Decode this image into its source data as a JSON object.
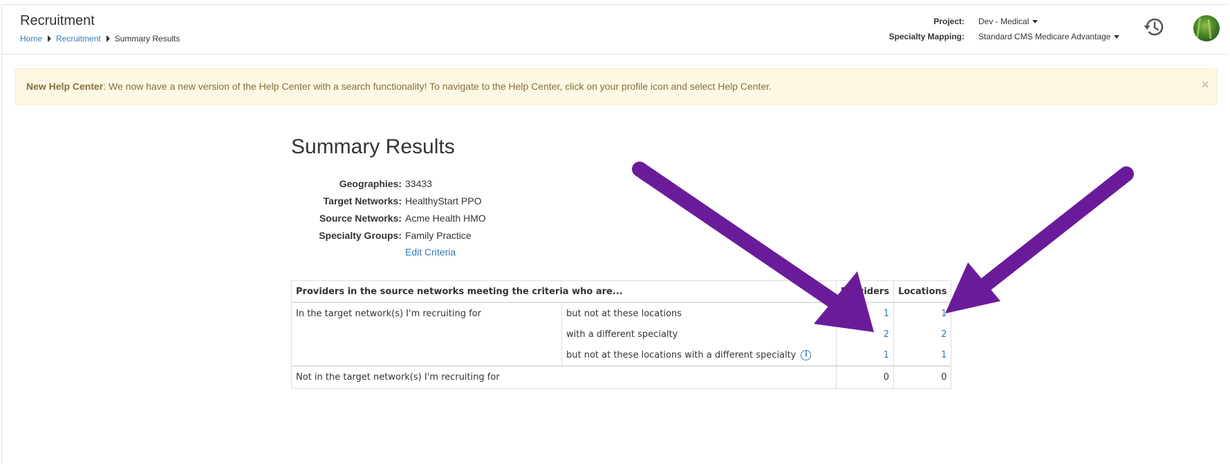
{
  "header": {
    "title": "Recruitment",
    "breadcrumb": [
      "Home",
      "Recruitment",
      "Summary Results"
    ],
    "project_label": "Project:",
    "project_value": "Dev - Medical",
    "mapping_label": "Specialty Mapping:",
    "mapping_value": "Standard CMS Medicare Advantage",
    "icons": [
      "history-icon",
      "avatar"
    ]
  },
  "alert": {
    "title": "New Help Center",
    "message": ": We now have a new version of the Help Center with a search functionality! To navigate to the Help Center, click on your profile icon and select Help Center.",
    "close": "×"
  },
  "main": {
    "title": "Summary Results",
    "criteria": [
      {
        "label": "Geographies:",
        "value": "33433"
      },
      {
        "label": "Target Networks:",
        "value": "HealthyStart PPO"
      },
      {
        "label": "Source Networks:",
        "value": "Acme Health HMO"
      },
      {
        "label": "Specialty Groups:",
        "value": "Family Practice"
      }
    ],
    "edit_link": "Edit Criteria"
  },
  "table": {
    "headers": [
      "Providers in the source networks meeting the criteria who are...",
      "Providers",
      "Locations"
    ],
    "group1_label": "In the target network(s) I'm recruiting for",
    "rows": [
      {
        "label": "but not at these locations",
        "providers": "1",
        "locations": "1"
      },
      {
        "label": "with a different specialty",
        "providers": "2",
        "locations": "2"
      },
      {
        "label": "but not at these locations with a different specialty",
        "providers": "1",
        "locations": "1"
      }
    ],
    "group2": {
      "label": "Not in the target network(s) I'm recruiting for",
      "providers": "0",
      "locations": "0"
    }
  },
  "colors": {
    "accent": "#337ab7",
    "arrow": "#6a1b9a",
    "alert_bg": "#fcf8e3",
    "alert_text": "#8a6d3b"
  }
}
